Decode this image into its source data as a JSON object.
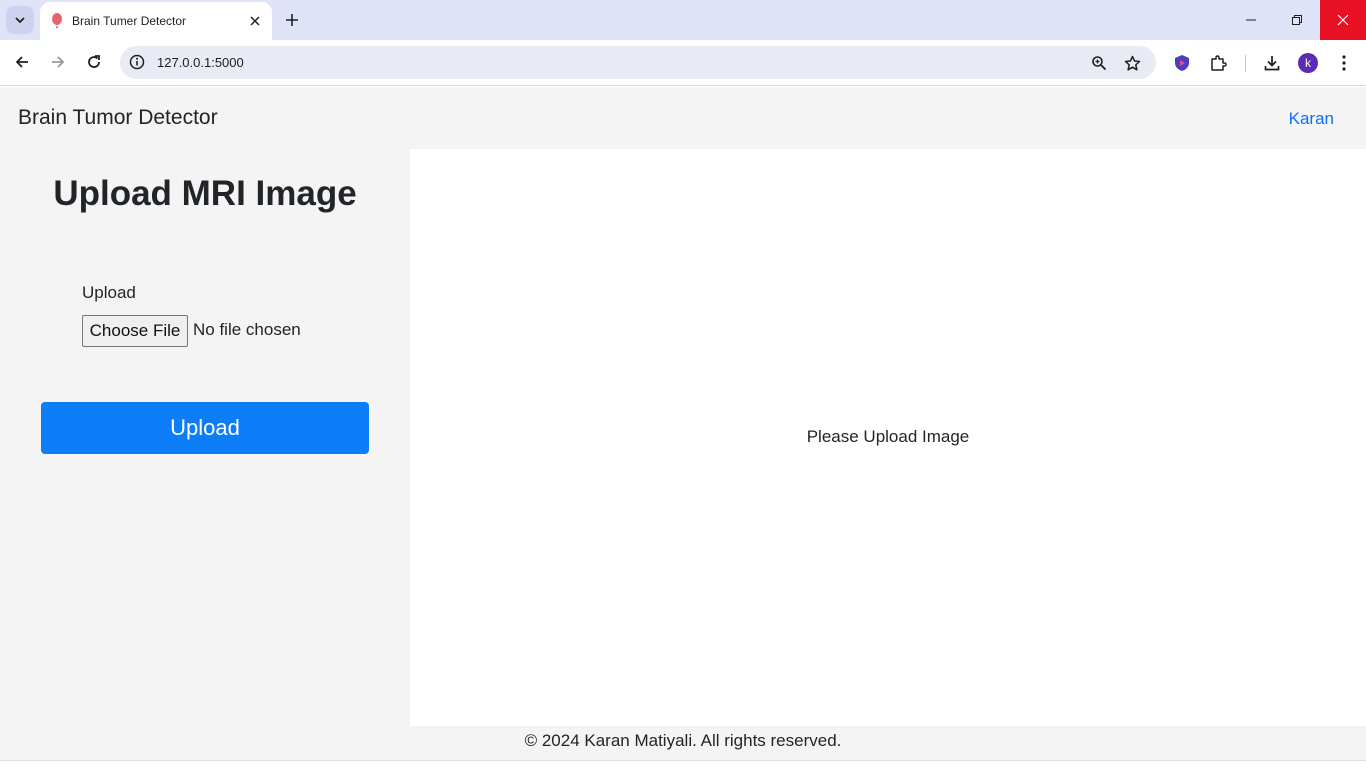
{
  "browser": {
    "tab": {
      "title": "Brain Tumer Detector",
      "favicon": "balloon-icon"
    },
    "address_bar": {
      "url": "127.0.0.1:5000"
    },
    "profile_initial": "k",
    "colors": {
      "tabstrip": "#dfe3f8",
      "close_hover": "#e81123",
      "avatar": "#5b2bb5"
    }
  },
  "navbar": {
    "brand": "Brain Tumor Detector",
    "user_link": "Karan"
  },
  "sidebar": {
    "heading": "Upload MRI Image",
    "upload_label": "Upload",
    "file_button": "Choose File",
    "file_status": "No file chosen",
    "submit_button": "Upload"
  },
  "result": {
    "message": "Please Upload Image"
  },
  "footer": {
    "text": "© 2024 Karan Matiyali. All rights reserved."
  },
  "theme": {
    "primary": "#0d7ef8",
    "link": "#0d6efd",
    "panel_bg": "#f4f4f4"
  }
}
